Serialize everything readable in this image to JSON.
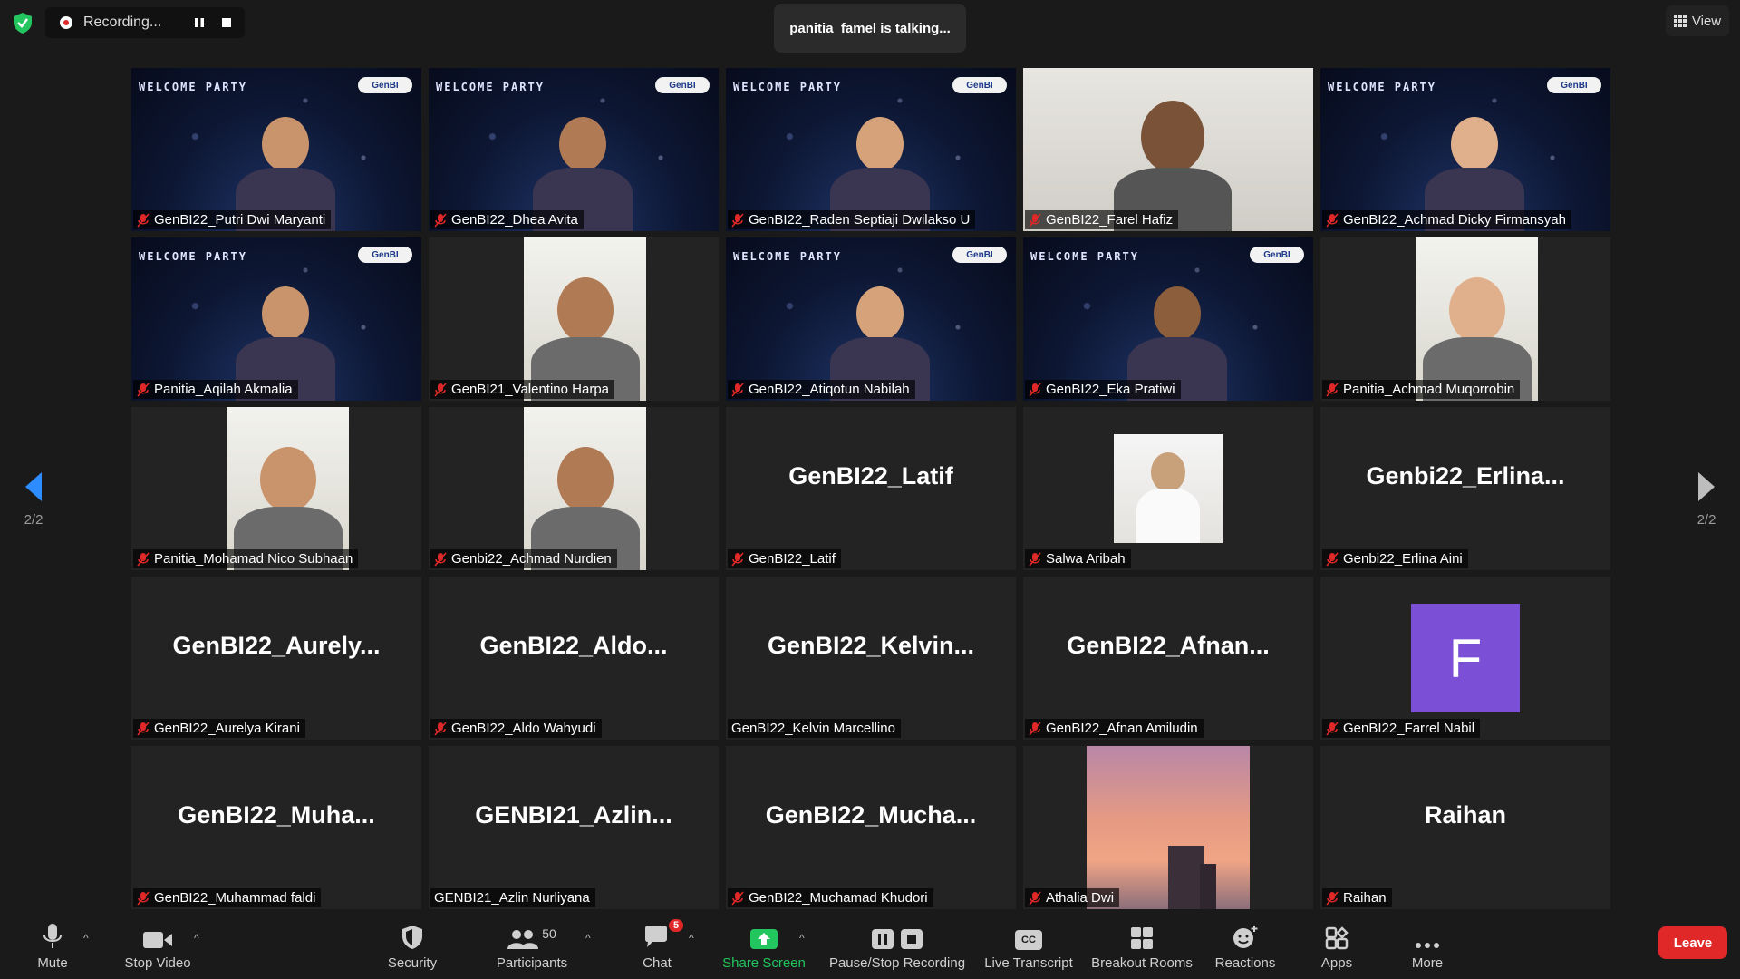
{
  "top": {
    "recording_label": "Recording...",
    "talking": "panitia_famel is talking...",
    "view_label": "View"
  },
  "pager": {
    "left": "2/2",
    "right": "2/2"
  },
  "tiles": [
    {
      "name": "GenBI22_Putri Dwi Maryanti",
      "muted": true,
      "kind": "party"
    },
    {
      "name": "GenBI22_Dhea Avita",
      "muted": true,
      "kind": "party"
    },
    {
      "name": "GenBI22_Raden Septiaji Dwilakso U",
      "muted": true,
      "kind": "party"
    },
    {
      "name": "GenBI22_Farel Hafiz",
      "muted": true,
      "kind": "photo"
    },
    {
      "name": "GenBI22_Achmad Dicky Firmansyah",
      "muted": true,
      "kind": "party"
    },
    {
      "name": "Panitia_Aqilah Akmalia",
      "muted": true,
      "kind": "party"
    },
    {
      "name": "GenBI21_Valentino Harpa",
      "muted": true,
      "kind": "portrait"
    },
    {
      "name": "GenBI22_Atiqotun Nabilah",
      "muted": true,
      "kind": "party"
    },
    {
      "name": "GenBI22_Eka Pratiwi",
      "muted": true,
      "kind": "party"
    },
    {
      "name": "Panitia_Achmad Muqorrobin",
      "muted": true,
      "kind": "portrait"
    },
    {
      "name": "Panitia_Mohamad Nico Subhaan",
      "muted": true,
      "kind": "portrait"
    },
    {
      "name": "Genbi22_Achmad Nurdien",
      "muted": true,
      "kind": "portrait"
    },
    {
      "name": "GenBI22_Latif",
      "muted": true,
      "kind": "text",
      "big": "GenBI22_Latif"
    },
    {
      "name": "Salwa Aribah",
      "muted": true,
      "kind": "avatar-photo"
    },
    {
      "name": "Genbi22_Erlina Aini",
      "muted": true,
      "kind": "text",
      "big": "Genbi22_Erlina..."
    },
    {
      "name": "GenBI22_Aurelya Kirani",
      "muted": true,
      "kind": "text",
      "big": "GenBI22_Aurely..."
    },
    {
      "name": "GenBI22_Aldo Wahyudi",
      "muted": true,
      "kind": "text",
      "big": "GenBI22_Aldo..."
    },
    {
      "name": "GenBI22_Kelvin Marcellino",
      "muted": false,
      "kind": "text",
      "big": "GenBI22_Kelvin..."
    },
    {
      "name": "GenBI22_Afnan Amiludin",
      "muted": true,
      "kind": "text",
      "big": "GenBI22_Afnan..."
    },
    {
      "name": "GenBI22_Farrel Nabil",
      "muted": true,
      "kind": "letter",
      "letter": "F"
    },
    {
      "name": "GenBI22_Muhammad faldi",
      "muted": true,
      "kind": "text",
      "big": "GenBI22_Muha..."
    },
    {
      "name": "GENBI21_Azlin Nurliyana",
      "muted": false,
      "kind": "text",
      "big": "GENBI21_Azlin..."
    },
    {
      "name": "GenBI22_Muchamad Khudori",
      "muted": true,
      "kind": "text",
      "big": "GenBI22_Mucha..."
    },
    {
      "name": "Athalia Dwi",
      "muted": true,
      "kind": "sky"
    },
    {
      "name": "Raihan",
      "muted": true,
      "kind": "text",
      "big": "Raihan"
    }
  ],
  "toolbar": {
    "mute": "Mute",
    "stop_video": "Stop Video",
    "security": "Security",
    "participants": "Participants",
    "participants_count": "50",
    "chat": "Chat",
    "chat_badge": "5",
    "share_screen": "Share Screen",
    "pause_stop_recording": "Pause/Stop Recording",
    "live_transcript": "Live Transcript",
    "live_transcript_icon_text": "CC",
    "breakout_rooms": "Breakout Rooms",
    "reactions": "Reactions",
    "apps": "Apps",
    "more": "More",
    "leave": "Leave"
  },
  "colors": {
    "accent_green": "#22c55e",
    "leave_red": "#e02828",
    "avatar_purple": "#7b4fd6",
    "arrow_blue": "#2d8cff"
  }
}
